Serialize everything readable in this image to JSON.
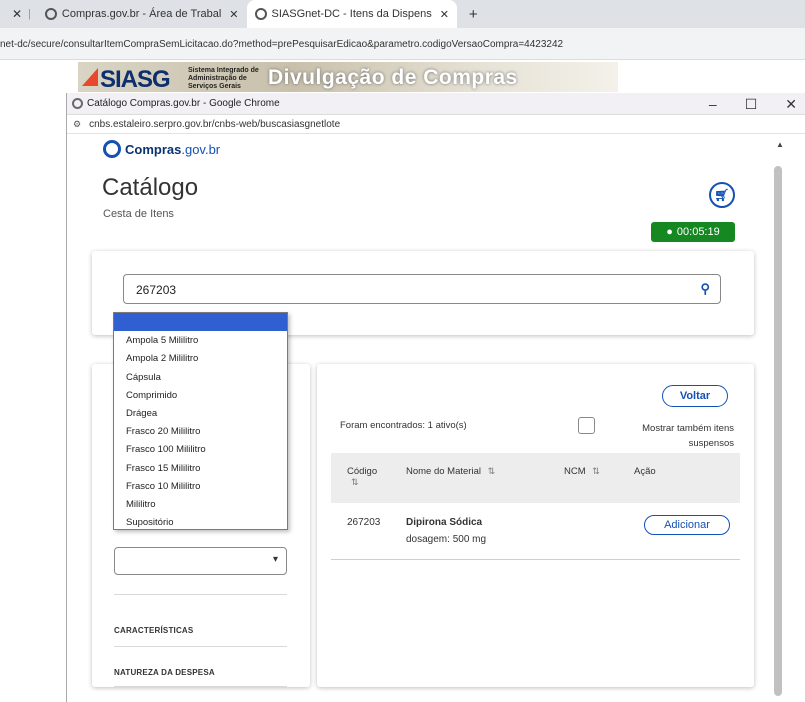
{
  "browser": {
    "tabs": [
      {
        "label": "Compras.gov.br - Área de Trabal",
        "active": false
      },
      {
        "label": "SIASGnet-DC - Itens da Dispens",
        "active": true
      }
    ],
    "url": "net-dc/secure/consultarItemCompraSemLicitacao.do?method=prePesquisarEdicao&parametro.codigoVersaoCompra=4423242"
  },
  "banner": {
    "logo": "SIASG",
    "subtitle": "Sistema Integrado de Administração de Serviços Gerais",
    "title": "Divulgação de Compras"
  },
  "popup": {
    "window_title": "Catálogo Compras.gov.br - Google Chrome",
    "url": "cnbs.estaleiro.serpro.gov.br/cnbs-web/buscasiasgnetlote",
    "window_buttons": {
      "minimize": "–",
      "maximize": "☐",
      "close": "✕"
    }
  },
  "brand": {
    "name": "Compras",
    "suffix": ".gov.br"
  },
  "page": {
    "title": "Catálogo",
    "subtitle": "Cesta de Itens",
    "timer": "00:05:19"
  },
  "search": {
    "value": "267203"
  },
  "filters": {
    "dropdown_options": [
      "",
      "Ampola 5 Mililitro",
      "Ampola 2 Mililitro",
      "Cápsula",
      "Comprimido",
      "Drágea",
      "Frasco 20 Mililitro",
      "Frasco 100 Mililitro",
      "Frasco 15 Mililitro",
      "Frasco 10 Mililitro",
      "Mililitro",
      "Supositório"
    ],
    "selected_index": 0,
    "characteristics_label": "CARACTERÍSTICAS",
    "expense_label": "NATUREZA DA DESPESA"
  },
  "results": {
    "back_label": "Voltar",
    "found_text": "Foram encontrados: 1 ativo(s)",
    "show_suspended": "Mostrar também itens suspensos",
    "columns": [
      "Código",
      "Nome do Material",
      "NCM",
      "Ação"
    ],
    "rows": [
      {
        "code": "267203",
        "name": "Dipirona Sódica",
        "detail": "dosagem: 500 mg",
        "action": "Adicionar"
      }
    ]
  },
  "icons": {
    "sort": "⇅",
    "cart": "cart-icon",
    "clock": "clock-icon",
    "search": "search-icon",
    "chevron": "chevron-down-icon"
  },
  "colors": {
    "primary": "#1351b4",
    "timer_bg": "#168821",
    "dropdown_selected": "#2f5fd0"
  }
}
